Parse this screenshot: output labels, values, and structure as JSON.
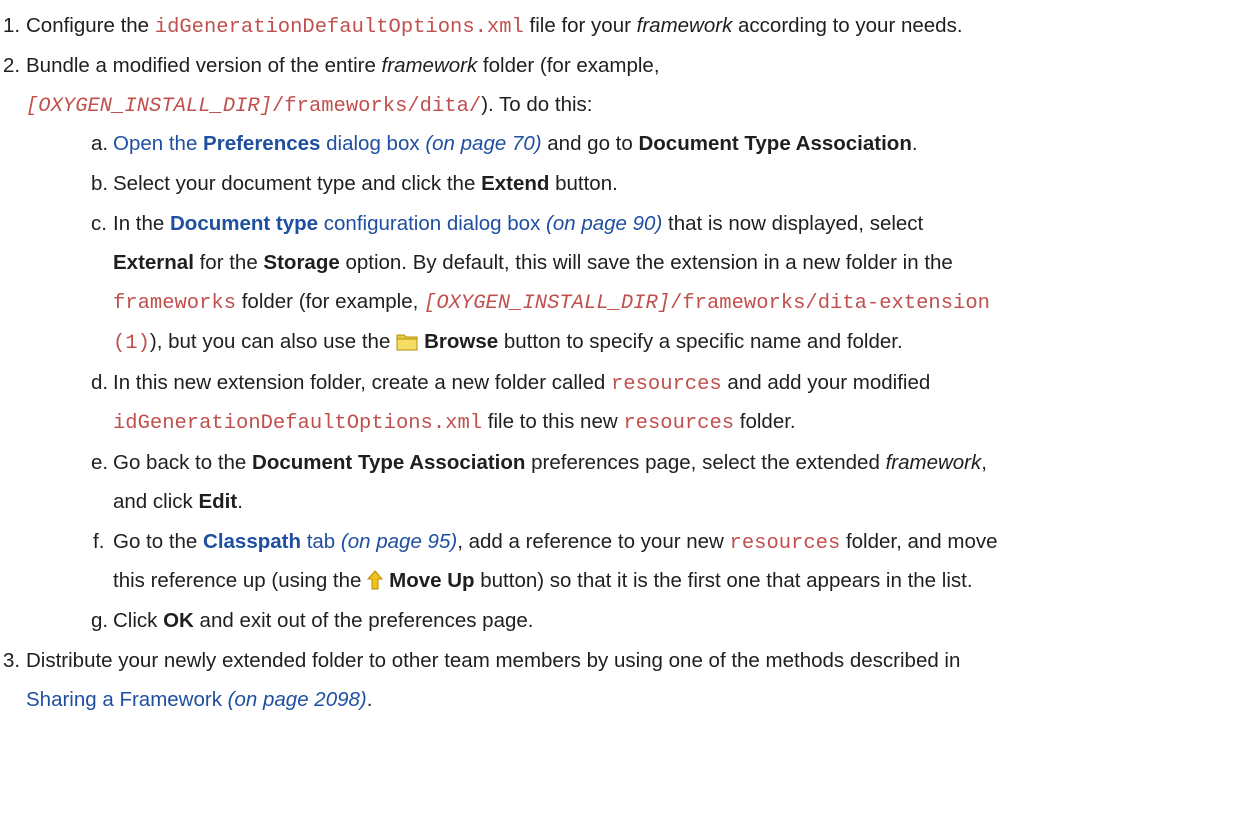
{
  "steps": [
    {
      "num": "1.",
      "before": "Configure the ",
      "file": "idGenerationDefaultOptions.xml",
      "mid": " file for your ",
      "framework": "framework",
      "after": " according to your needs."
    },
    {
      "num": "2.",
      "l1_a": "Bundle a modified version of the entire ",
      "l1_framework": "framework",
      "l1_b": " folder (for example,",
      "l2_var": "[OXYGEN_INSTALL_DIR]",
      "l2_path": "/frameworks/dita/",
      "l2_after": "). To do this:",
      "substeps": {
        "a": {
          "num": "a.",
          "link_pre": "Open the ",
          "link_bold": "Preferences",
          "link_post": " dialog box",
          "pageref": "(on page 70)",
          "mid": " and go to ",
          "target": "Document Type Association",
          "end": "."
        },
        "b": {
          "num": "b.",
          "pre": "Select your document type and click the ",
          "bold": "Extend",
          "post": " button."
        },
        "c": {
          "num": "c.",
          "pre": "In the ",
          "link_bold": "Document type",
          "link_post": " configuration dialog box",
          "pageref": "(on page 90)",
          "post": " that is now displayed, select",
          "l2_external": "External",
          "l2_mid": " for the ",
          "l2_storage": "Storage",
          "l2_after": " option. By default, this will save the extension in a new folder in the",
          "l3_code": "frameworks",
          "l3_mid": " folder (for example, ",
          "l3_var": "[OXYGEN_INSTALL_DIR]",
          "l3_path": "/frameworks/dita-extension",
          "l4_code": "(1)",
          "l4_mid": "), but you can also use the ",
          "l4_browse": "Browse",
          "l4_after": " button to specify a specific name and folder."
        },
        "d": {
          "num": "d.",
          "pre": "In this new extension folder, create a new folder called ",
          "code": "resources",
          "post": " and add your modified",
          "l2_file": "idGenerationDefaultOptions.xml",
          "l2_mid": " file to this new ",
          "l2_code": "resources",
          "l2_after": " folder."
        },
        "e": {
          "num": "e.",
          "pre": "Go back to the ",
          "bold": "Document Type Association",
          "mid": " preferences page, select the extended ",
          "framework": "framework",
          "end": ",",
          "l2_pre": "and click ",
          "l2_bold": "Edit",
          "l2_end": "."
        },
        "f": {
          "num": "f.",
          "pre": "Go to the ",
          "link_bold": "Classpath",
          "link_post": " tab",
          "pageref": "(on page 95)",
          "mid": ", add a reference to your new ",
          "code": "resources",
          "post": " folder, and move",
          "l2_pre": "this reference up (using the ",
          "l2_bold": "Move Up",
          "l2_post": " button) so that it is the first one that appears in the list."
        },
        "g": {
          "num": "g.",
          "pre": "Click ",
          "bold": "OK",
          "post": " and exit out of the preferences page."
        }
      }
    },
    {
      "num": "3.",
      "text": "Distribute your newly extended folder to other team members by using one of the methods described in",
      "link": "Sharing a Framework",
      "pageref": "(on page 2098)",
      "end": "."
    }
  ],
  "icons": {
    "folder": "folder-icon",
    "arrow": "move-up-arrow-icon",
    "folder_color": "#e8c93a",
    "arrow_color": "#f2c21c"
  },
  "colors": {
    "link": "#1f4fa0",
    "code": "#c0504d",
    "text": "#1f1f1f"
  }
}
